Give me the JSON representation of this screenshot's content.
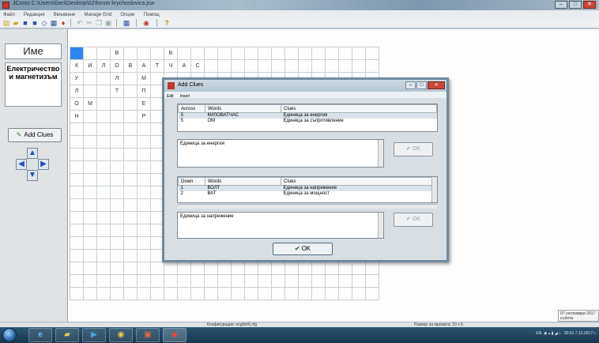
{
  "window": {
    "title": "JCross C:\\Users\\Geri\\Desktop\\02\\forum krychoslovica.jcw",
    "controls": [
      "–",
      "□",
      "✕"
    ]
  },
  "menubar": [
    "Файл",
    "Редакция",
    "Вмъкване",
    "Manage Grid",
    "Опции",
    "Помощ"
  ],
  "toolbar": {
    "help_label": "?"
  },
  "left_panel": {
    "name_label": "Име",
    "word_label": "Електричество и магнетизъм",
    "add_clues_label": "Add Clues",
    "arrow_up": "▲",
    "arrow_down": "▼",
    "arrow_left": "◀",
    "arrow_right": "▶"
  },
  "grid": {
    "rows": [
      [
        "",
        "",
        "",
        "В",
        "",
        "",
        "",
        "В",
        "",
        "",
        "",
        "",
        "",
        "",
        "",
        "",
        "",
        "",
        "",
        "",
        "",
        "",
        ""
      ],
      [
        "К",
        "И",
        "Л",
        "О",
        "В",
        "А",
        "Т",
        "Ч",
        "А",
        "С",
        "",
        "",
        "",
        "",
        "",
        "",
        "",
        "",
        "",
        "",
        "",
        "",
        ""
      ],
      [
        "У",
        "",
        "",
        "Л",
        "",
        "М",
        "",
        "",
        "",
        "",
        "",
        "",
        "",
        "",
        "",
        "",
        "",
        "",
        "",
        "",
        "",
        "",
        ""
      ],
      [
        "Л",
        "",
        "",
        "Т",
        "",
        "П",
        "",
        "",
        "",
        "",
        "",
        "",
        "",
        "",
        "",
        "",
        "",
        "",
        "",
        "",
        "",
        "",
        ""
      ],
      [
        "О",
        "М",
        "",
        "",
        "",
        "Е",
        "",
        "",
        "",
        "",
        "",
        "",
        "",
        "",
        "",
        "",
        "",
        "",
        "",
        "",
        "",
        "",
        ""
      ],
      [
        "Н",
        "",
        "",
        "",
        "",
        "Р",
        "",
        "",
        "",
        "",
        "",
        "",
        "",
        "",
        "",
        "",
        "",
        "",
        "",
        "",
        "",
        "",
        ""
      ]
    ]
  },
  "dialog": {
    "title": "Add Clues",
    "menu": [
      "Edit",
      "Insert"
    ],
    "across": {
      "headers": [
        "Across",
        "Words",
        "Clues"
      ],
      "rows": [
        [
          "3",
          "КИЛОВАТЧАС",
          "Единица за енергия"
        ],
        [
          "5",
          "ОМ",
          "Единица за съпротивление"
        ]
      ],
      "clue_text": "Единица за енергия",
      "ok_label": "OK"
    },
    "down": {
      "headers": [
        "Down",
        "Words",
        "Clues"
      ],
      "rows": [
        [
          "1",
          "ВОЛТ",
          "Единица за напрежение"
        ],
        [
          "2",
          "ВАТ",
          "Единица за мощност"
        ]
      ],
      "clue_text": "Единица за напрежение",
      "ok_label": "OK"
    },
    "main_ok_label": "OK"
  },
  "statusbar": {
    "config": "Конфигурация: english6.cfg",
    "grid_size": "Размер на мрежата: 10 x 6"
  },
  "toast": {
    "line1": "07 септември 2017",
    "line2": "събота"
  },
  "taskbar": {
    "tray_lang": "EN",
    "tray_time": "20:01",
    "tray_date": "7.10.2017 г."
  },
  "colors": {
    "selected_cell": "#2e86ee",
    "title_bar": "#7d97ad",
    "taskbar": "#18374e"
  }
}
